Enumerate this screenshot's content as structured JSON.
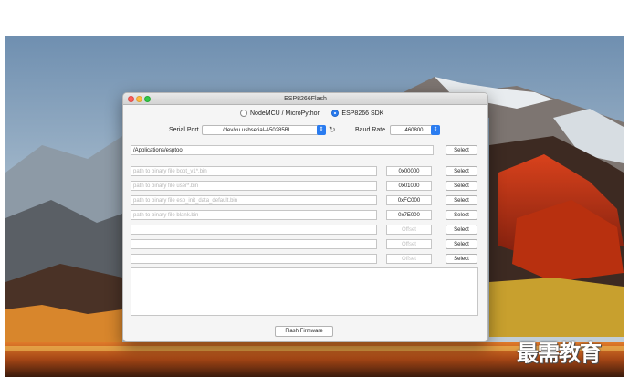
{
  "window": {
    "title": "ESP8266Flash"
  },
  "mode": {
    "options": [
      {
        "label": "NodeMCU / MicroPython",
        "checked": false
      },
      {
        "label": "ESP8266 SDK",
        "checked": true
      }
    ]
  },
  "serial": {
    "port_label": "Serial Port",
    "port_value": "/dev/cu.usbserial-A50285BI",
    "baud_label": "Baud Rate",
    "baud_value": "460800"
  },
  "tool_path": {
    "value": "/Applications/esptool",
    "select_label": "Select"
  },
  "files": [
    {
      "path": "path to binary file  boot_v1*.bin",
      "address": "0x00000",
      "select": "Select",
      "placeholder": true,
      "addr_disabled": false
    },
    {
      "path": "path to binary file  user*.bin",
      "address": "0x01000",
      "select": "Select",
      "placeholder": true,
      "addr_disabled": false
    },
    {
      "path": "path to binary file  esp_init_data_default.bin",
      "address": "0xFC000",
      "select": "Select",
      "placeholder": true,
      "addr_disabled": false
    },
    {
      "path": "path to binary file  blank.bin",
      "address": "0x7E000",
      "select": "Select",
      "placeholder": true,
      "addr_disabled": false
    },
    {
      "path": "",
      "address": "Offset",
      "select": "Select",
      "placeholder": true,
      "addr_disabled": true
    },
    {
      "path": "",
      "address": "Offset",
      "select": "Select",
      "placeholder": true,
      "addr_disabled": true
    },
    {
      "path": "",
      "address": "Offset",
      "select": "Select",
      "placeholder": true,
      "addr_disabled": true
    }
  ],
  "actions": {
    "flash_label": "Flash Firmware"
  },
  "watermark": "最需教育",
  "icons": {
    "refresh": "refresh-icon",
    "dropdown": "chevron-updown-icon"
  }
}
